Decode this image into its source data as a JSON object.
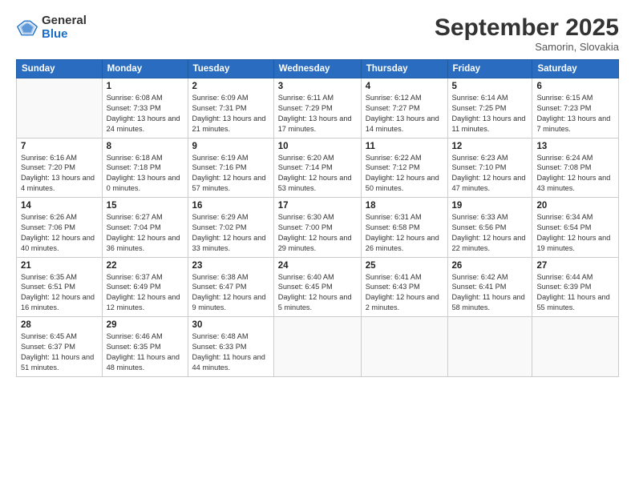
{
  "logo": {
    "general": "General",
    "blue": "Blue"
  },
  "title": "September 2025",
  "subtitle": "Samorin, Slovakia",
  "days_header": [
    "Sunday",
    "Monday",
    "Tuesday",
    "Wednesday",
    "Thursday",
    "Friday",
    "Saturday"
  ],
  "weeks": [
    [
      {
        "day": "",
        "info": ""
      },
      {
        "day": "1",
        "info": "Sunrise: 6:08 AM\nSunset: 7:33 PM\nDaylight: 13 hours\nand 24 minutes."
      },
      {
        "day": "2",
        "info": "Sunrise: 6:09 AM\nSunset: 7:31 PM\nDaylight: 13 hours\nand 21 minutes."
      },
      {
        "day": "3",
        "info": "Sunrise: 6:11 AM\nSunset: 7:29 PM\nDaylight: 13 hours\nand 17 minutes."
      },
      {
        "day": "4",
        "info": "Sunrise: 6:12 AM\nSunset: 7:27 PM\nDaylight: 13 hours\nand 14 minutes."
      },
      {
        "day": "5",
        "info": "Sunrise: 6:14 AM\nSunset: 7:25 PM\nDaylight: 13 hours\nand 11 minutes."
      },
      {
        "day": "6",
        "info": "Sunrise: 6:15 AM\nSunset: 7:23 PM\nDaylight: 13 hours\nand 7 minutes."
      }
    ],
    [
      {
        "day": "7",
        "info": "Sunrise: 6:16 AM\nSunset: 7:20 PM\nDaylight: 13 hours\nand 4 minutes."
      },
      {
        "day": "8",
        "info": "Sunrise: 6:18 AM\nSunset: 7:18 PM\nDaylight: 13 hours\nand 0 minutes."
      },
      {
        "day": "9",
        "info": "Sunrise: 6:19 AM\nSunset: 7:16 PM\nDaylight: 12 hours\nand 57 minutes."
      },
      {
        "day": "10",
        "info": "Sunrise: 6:20 AM\nSunset: 7:14 PM\nDaylight: 12 hours\nand 53 minutes."
      },
      {
        "day": "11",
        "info": "Sunrise: 6:22 AM\nSunset: 7:12 PM\nDaylight: 12 hours\nand 50 minutes."
      },
      {
        "day": "12",
        "info": "Sunrise: 6:23 AM\nSunset: 7:10 PM\nDaylight: 12 hours\nand 47 minutes."
      },
      {
        "day": "13",
        "info": "Sunrise: 6:24 AM\nSunset: 7:08 PM\nDaylight: 12 hours\nand 43 minutes."
      }
    ],
    [
      {
        "day": "14",
        "info": "Sunrise: 6:26 AM\nSunset: 7:06 PM\nDaylight: 12 hours\nand 40 minutes."
      },
      {
        "day": "15",
        "info": "Sunrise: 6:27 AM\nSunset: 7:04 PM\nDaylight: 12 hours\nand 36 minutes."
      },
      {
        "day": "16",
        "info": "Sunrise: 6:29 AM\nSunset: 7:02 PM\nDaylight: 12 hours\nand 33 minutes."
      },
      {
        "day": "17",
        "info": "Sunrise: 6:30 AM\nSunset: 7:00 PM\nDaylight: 12 hours\nand 29 minutes."
      },
      {
        "day": "18",
        "info": "Sunrise: 6:31 AM\nSunset: 6:58 PM\nDaylight: 12 hours\nand 26 minutes."
      },
      {
        "day": "19",
        "info": "Sunrise: 6:33 AM\nSunset: 6:56 PM\nDaylight: 12 hours\nand 22 minutes."
      },
      {
        "day": "20",
        "info": "Sunrise: 6:34 AM\nSunset: 6:54 PM\nDaylight: 12 hours\nand 19 minutes."
      }
    ],
    [
      {
        "day": "21",
        "info": "Sunrise: 6:35 AM\nSunset: 6:51 PM\nDaylight: 12 hours\nand 16 minutes."
      },
      {
        "day": "22",
        "info": "Sunrise: 6:37 AM\nSunset: 6:49 PM\nDaylight: 12 hours\nand 12 minutes."
      },
      {
        "day": "23",
        "info": "Sunrise: 6:38 AM\nSunset: 6:47 PM\nDaylight: 12 hours\nand 9 minutes."
      },
      {
        "day": "24",
        "info": "Sunrise: 6:40 AM\nSunset: 6:45 PM\nDaylight: 12 hours\nand 5 minutes."
      },
      {
        "day": "25",
        "info": "Sunrise: 6:41 AM\nSunset: 6:43 PM\nDaylight: 12 hours\nand 2 minutes."
      },
      {
        "day": "26",
        "info": "Sunrise: 6:42 AM\nSunset: 6:41 PM\nDaylight: 11 hours\nand 58 minutes."
      },
      {
        "day": "27",
        "info": "Sunrise: 6:44 AM\nSunset: 6:39 PM\nDaylight: 11 hours\nand 55 minutes."
      }
    ],
    [
      {
        "day": "28",
        "info": "Sunrise: 6:45 AM\nSunset: 6:37 PM\nDaylight: 11 hours\nand 51 minutes."
      },
      {
        "day": "29",
        "info": "Sunrise: 6:46 AM\nSunset: 6:35 PM\nDaylight: 11 hours\nand 48 minutes."
      },
      {
        "day": "30",
        "info": "Sunrise: 6:48 AM\nSunset: 6:33 PM\nDaylight: 11 hours\nand 44 minutes."
      },
      {
        "day": "",
        "info": ""
      },
      {
        "day": "",
        "info": ""
      },
      {
        "day": "",
        "info": ""
      },
      {
        "day": "",
        "info": ""
      }
    ]
  ]
}
